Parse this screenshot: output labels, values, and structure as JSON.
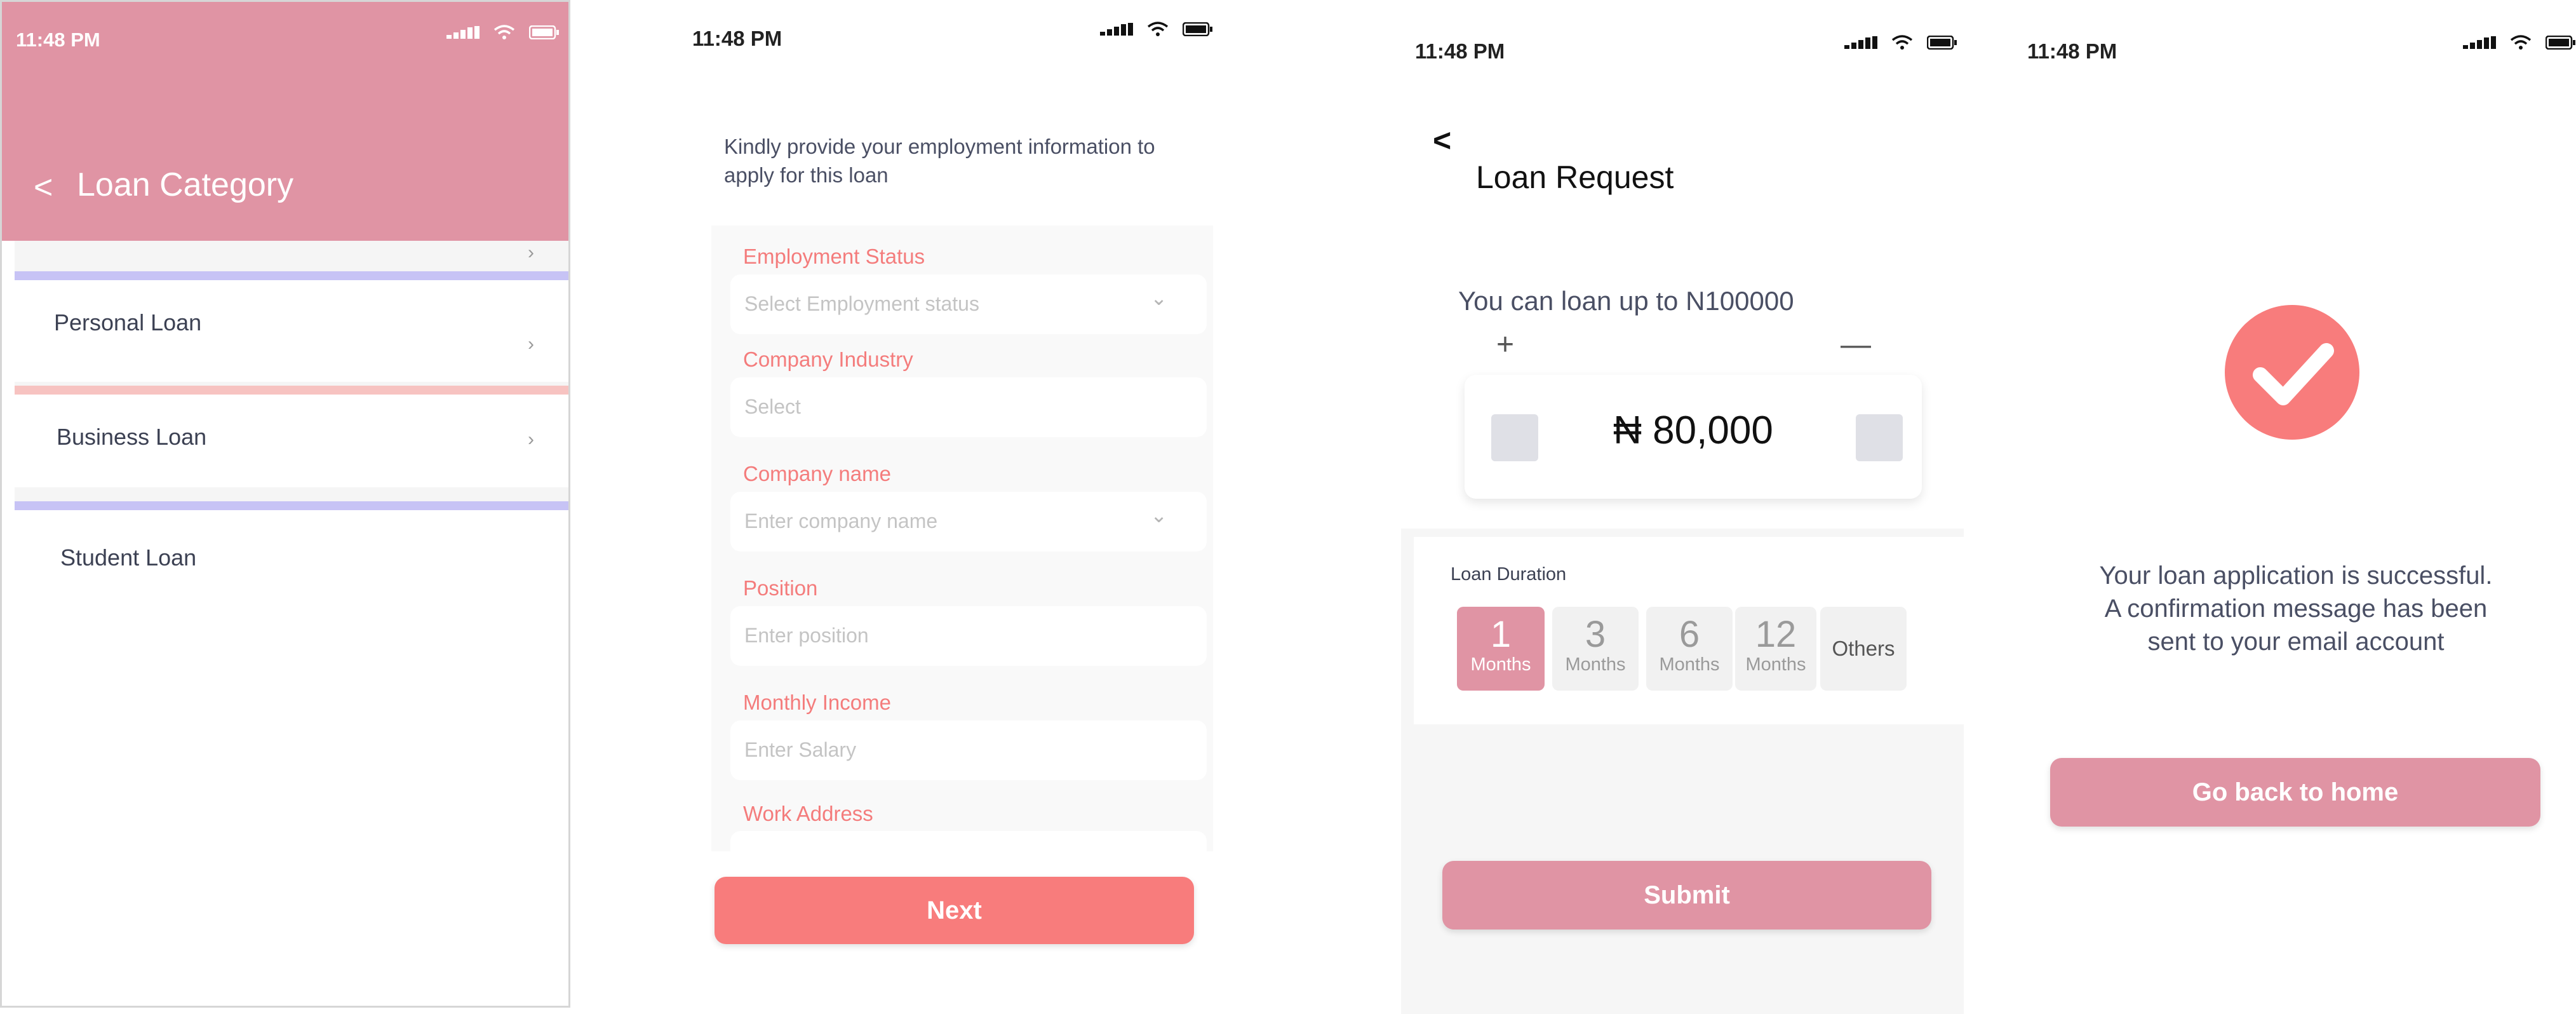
{
  "status_time": "11:48 PM",
  "screen1": {
    "back_label": "<",
    "title": "Loan Category",
    "categories": [
      {
        "label": "Personal Loan"
      },
      {
        "label": "Business Loan"
      },
      {
        "label": "Student Loan"
      }
    ],
    "colors": {
      "header": "#e094a4",
      "bar_purple": "#c7c3f5",
      "bar_pink": "#f7c3c1"
    }
  },
  "screen2": {
    "intro": "Kindly provide your employment information to apply for this loan",
    "fields": [
      {
        "label": "Employment Status",
        "placeholder": "Select Employment status"
      },
      {
        "label": "Company Industry",
        "placeholder": "Select"
      },
      {
        "label": "Company name",
        "placeholder": "Enter company name"
      },
      {
        "label": "Position",
        "placeholder": "Enter position"
      },
      {
        "label": "Monthly Income",
        "placeholder": "Enter Salary"
      },
      {
        "label": "Work Address",
        "placeholder": ""
      }
    ],
    "next_label": "Next",
    "colors": {
      "accent": "#f87c7c"
    }
  },
  "screen3": {
    "back_label": "<",
    "title": "Loan Request",
    "limit_text": "You can loan up to N100000",
    "plus": "+",
    "minus": "—",
    "amount": "₦ 80,000",
    "duration_label": "Loan Duration",
    "durations": [
      {
        "num": "1",
        "unit": "Months"
      },
      {
        "num": "3",
        "unit": "Months"
      },
      {
        "num": "6",
        "unit": "Months"
      },
      {
        "num": "12",
        "unit": "Months"
      }
    ],
    "others_label": "Others",
    "selected_duration": "1",
    "submit_label": "Submit"
  },
  "screen4": {
    "message_line1": "Your loan application is successful.",
    "message_line2": "A confirmation message has been",
    "message_line3": "sent to your email account",
    "home_label": "Go back to home",
    "icon": "checkmark-icon"
  }
}
